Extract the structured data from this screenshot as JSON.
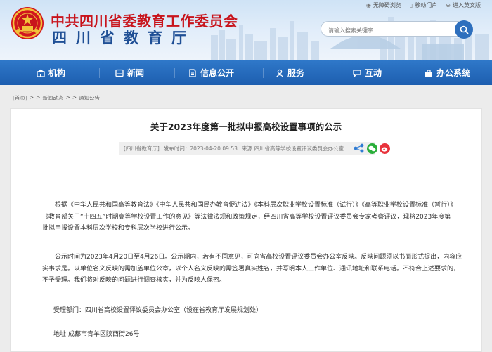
{
  "header": {
    "title": "中共四川省委教育工作委员会",
    "subtitle": "四川省教育厅",
    "links": [
      {
        "label": "无障碍浏览",
        "icon": "accessibility-icon"
      },
      {
        "label": "移动门户",
        "icon": "mobile-icon"
      },
      {
        "label": "进入英文版",
        "icon": "english-icon"
      }
    ],
    "search": {
      "placeholder": "请输入搜索关键字"
    }
  },
  "nav": {
    "items": [
      {
        "label": "机构",
        "icon": "org-icon"
      },
      {
        "label": "新闻",
        "icon": "news-icon"
      },
      {
        "label": "信息公开",
        "icon": "info-icon"
      },
      {
        "label": "服务",
        "icon": "service-icon"
      },
      {
        "label": "互动",
        "icon": "interact-icon"
      },
      {
        "label": "办公系统",
        "icon": "office-icon"
      }
    ]
  },
  "breadcrumb": {
    "items": [
      "[首页]",
      ">",
      ">",
      "新闻动态",
      ">",
      ">",
      "通知公告"
    ]
  },
  "article": {
    "title": "关于2023年度第一批拟申报高校设置事项的公示",
    "meta": {
      "source_tag": "[四川省教育厅]",
      "published": "发布时间：2023-04-20 09:53",
      "origin": "来源:四川省高等学校设置评议委员会办公室"
    },
    "paragraphs": [
      "根据《中华人民共和国高等教育法》《中华人民共和国民办教育促进法》《本科层次职业学校设置标准（试行）》《高等职业学校设置标准（暂行）》《教育部关于“十四五”时期高等学校设置工作的意见》等法律法规和政策规定，经四川省高等学校设置评议委员会专家考察评议，现将2023年度第一批拟申报设置本科层次学校和专科层次学校进行公示。",
      "公示时间为2023年4月20日至4月26日。公示期内，若有不同意见，可向省高校设置评议委员会办公室反映。反映问题须以书面形式提出，内容应实事求是。以单位名义反映的需加盖单位公章，以个人名义反映的需签署真实姓名，并写明本人工作单位、通讯地址和联系电话。不符合上述要求的，不予受理。我们将对反映的问题进行调查核实，并为反映人保密。"
    ],
    "dept": "受理部门：四川省高校设置评议委员会办公室（设在省教育厅发展规划处）",
    "address": "地址:成都市青羊区陕西街26号"
  },
  "colors": {
    "nav_blue": "#1d5eaf",
    "title_red": "#c8141c",
    "subtitle_blue": "#1f4f95"
  }
}
